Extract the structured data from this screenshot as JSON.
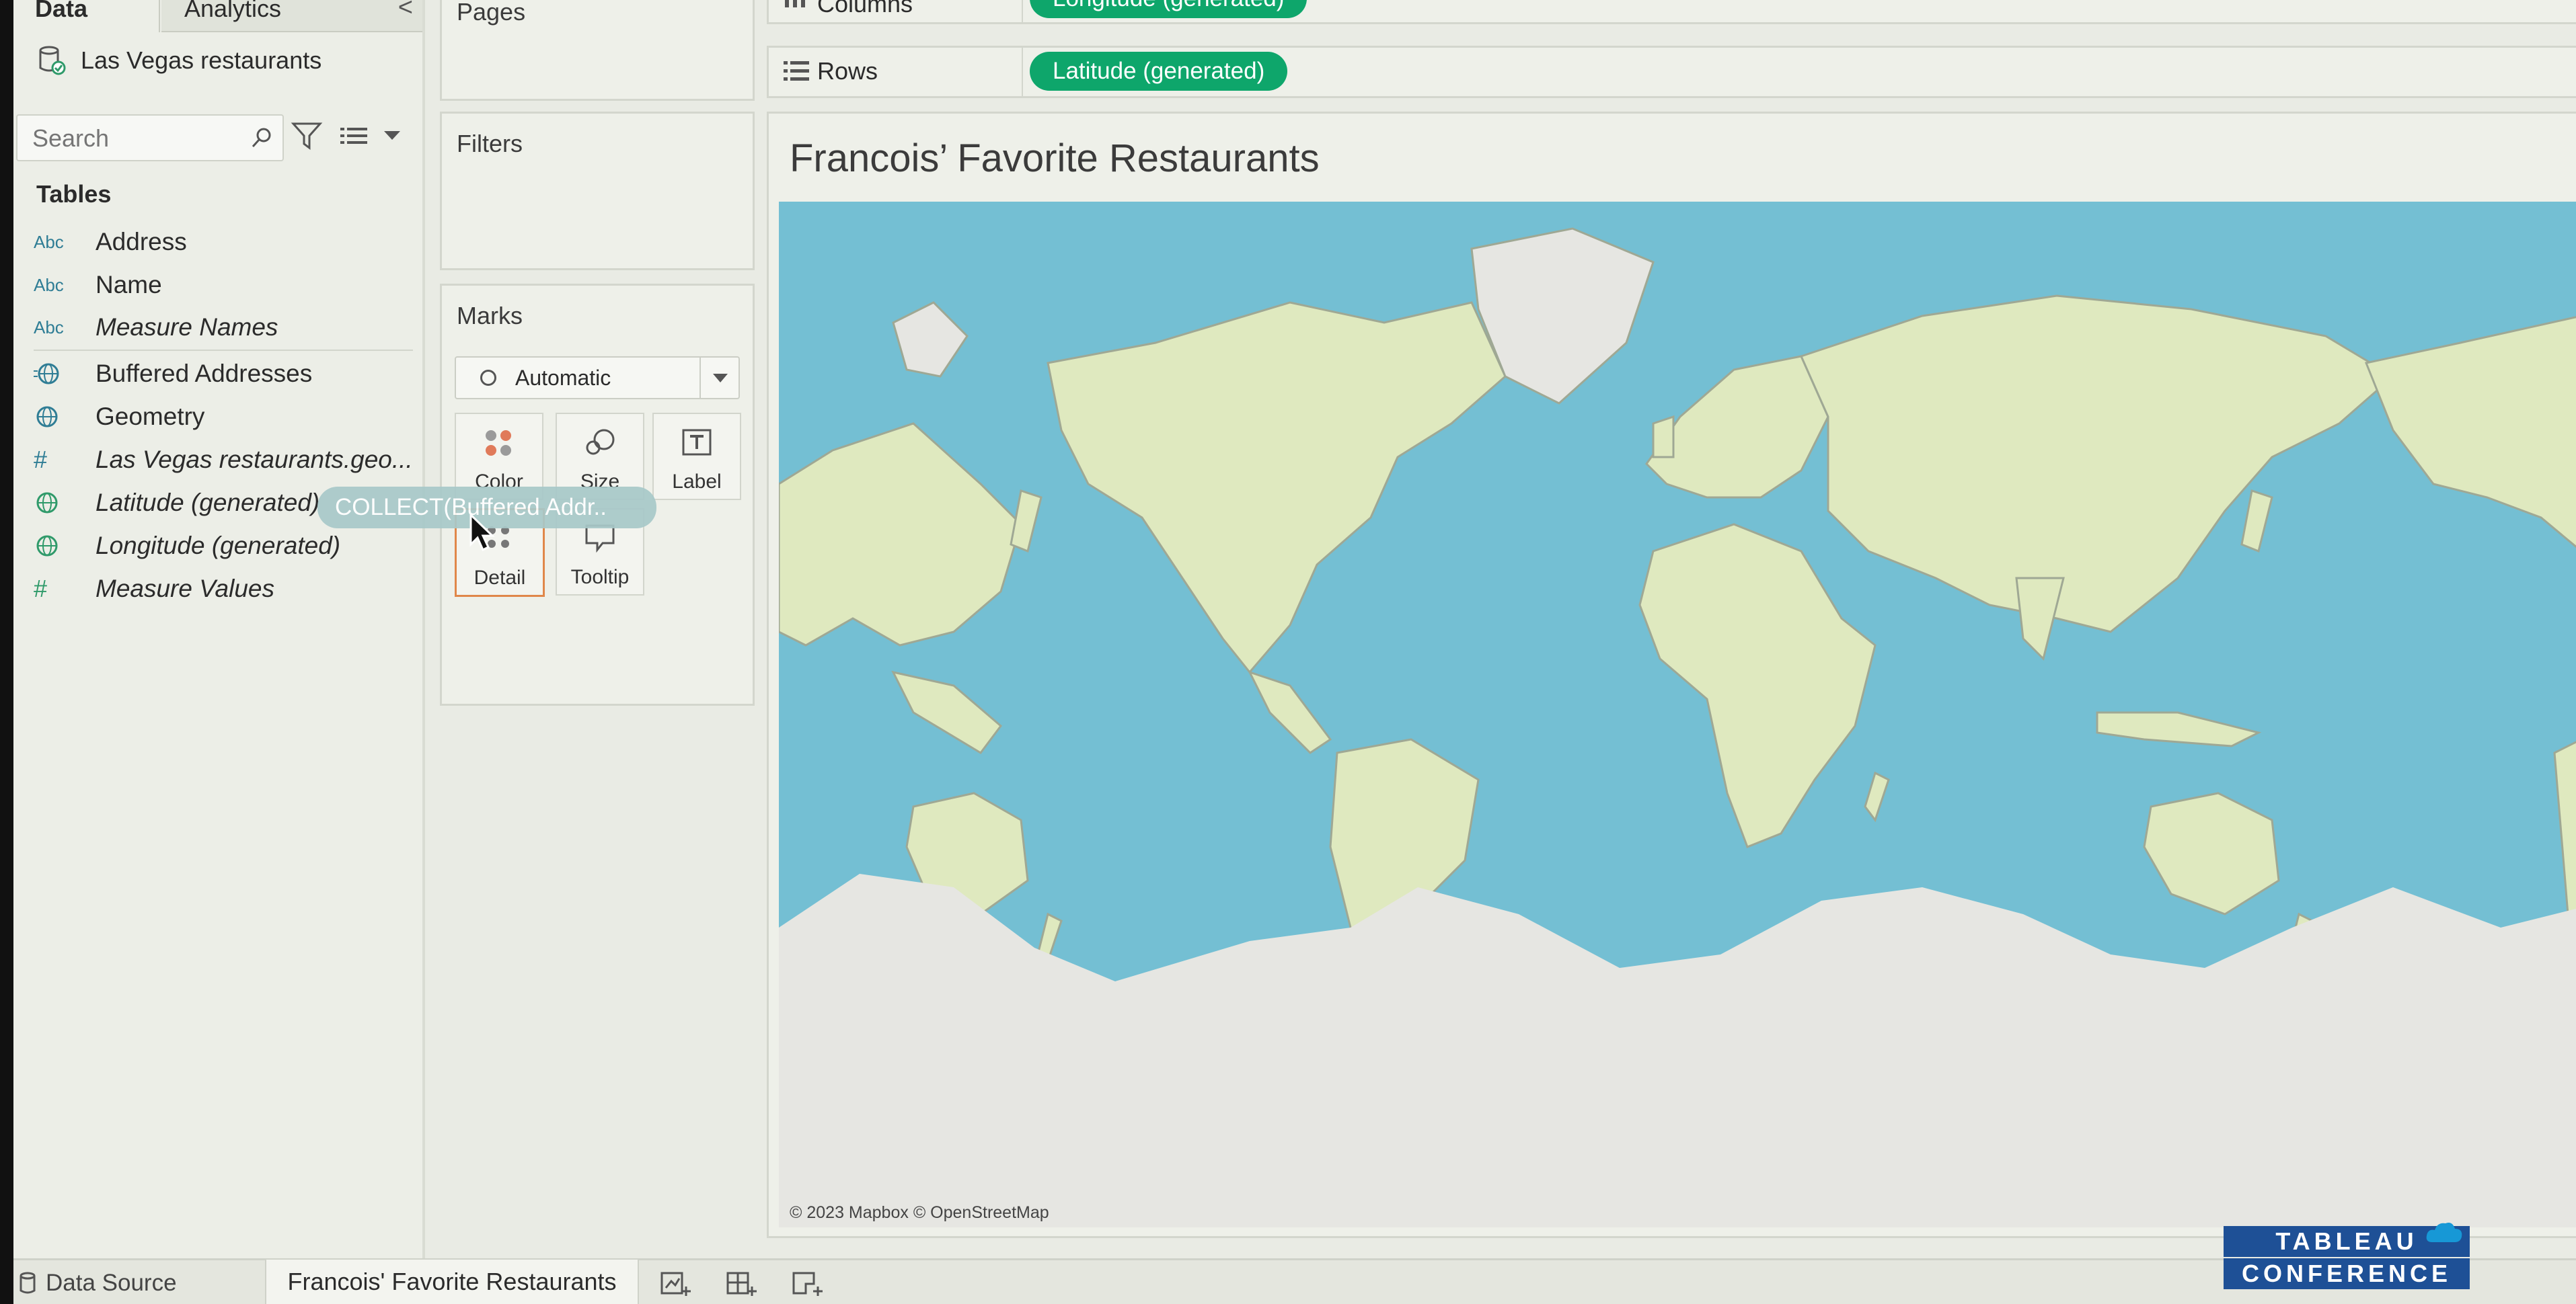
{
  "data_pane": {
    "tab_data": "Data",
    "tab_analytics": "Analytics",
    "data_source": "Las Vegas restaurants",
    "search_placeholder": "Search",
    "tables_header": "Tables",
    "fields": [
      {
        "type": "Abc",
        "name": "Address"
      },
      {
        "type": "Abc",
        "name": "Name"
      },
      {
        "type": "Abc",
        "name": "Measure Names"
      },
      {
        "type": "geo",
        "name": "Buffered Addresses"
      },
      {
        "type": "geo",
        "name": "Geometry"
      },
      {
        "type": "#",
        "name": "Las Vegas restaurants.geo..."
      },
      {
        "type": "geo",
        "name": "Latitude (generated)"
      },
      {
        "type": "geo",
        "name": "Longitude (generated)"
      },
      {
        "type": "#",
        "name": "Measure Values"
      }
    ],
    "drag_ghost": "COLLECT(Buffered Addr.."
  },
  "cards": {
    "pages": "Pages",
    "filters": "Filters",
    "marks": "Marks",
    "mark_type": "Automatic",
    "buttons": {
      "color": "Color",
      "size": "Size",
      "label": "Label",
      "detail": "Detail",
      "tooltip": "Tooltip"
    }
  },
  "shelves": {
    "columns_label": "Columns",
    "columns_pill": "Longitude (generated)",
    "rows_label": "Rows",
    "rows_pill": "Latitude (generated)"
  },
  "view": {
    "title": "Francois’ Favorite Restaurants",
    "credit": "© 2023 Mapbox © OpenStreetMap"
  },
  "bottom": {
    "data_source_tab": "Data Source",
    "sheet_tab": "Francois' Favorite Restaurants"
  },
  "logo": {
    "line1": "TABLEAU",
    "line2": "CONFERENCE"
  },
  "colors": {
    "pill": "#0ea66b",
    "ocean": "#74bfd3",
    "land": "#dfe9bf",
    "ice": "#e6e6e2",
    "logo": "#1e5096"
  }
}
